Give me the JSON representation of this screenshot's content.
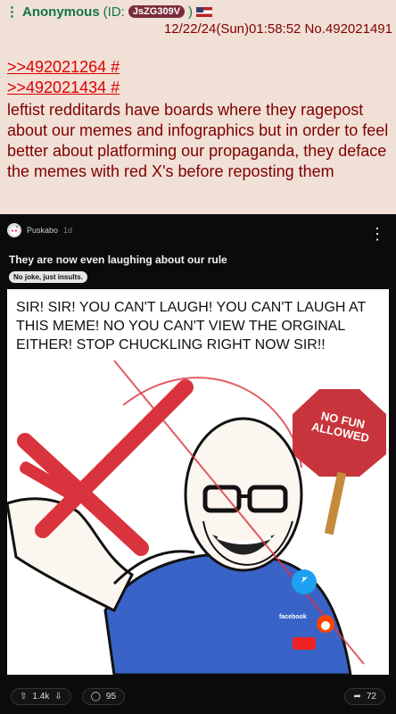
{
  "post": {
    "menu_icon": "vertical-dots-icon",
    "name": "Anonymous",
    "id_prefix": "(ID:",
    "id_value": "JsZG309V",
    "id_suffix": ")",
    "flag": "us-flag-icon",
    "datetime_num": "12/22/24(Sun)01:58:52 No.492021491",
    "quotes": [
      ">>492021264 #",
      ">>492021434 #"
    ],
    "body": "leftist redditards have boards where they ragepost about our memes and infographics but in order to feel better about platforming our propaganda, they deface the memes with red X's before reposting them"
  },
  "reddit": {
    "user": "Puskabo",
    "time": "1d",
    "more_icon": "more-vertical-icon",
    "title": "They are now even laughing about our rule",
    "flair": "No joke, just insults.",
    "meme_text": "SIR! SIR! YOU CAN'T LAUGH! YOU CAN'T LAUGH AT THIS MEME! NO YOU CAN'T VIEW THE ORGINAL EITHER! STOP CHUCKLING RIGHT NOW SIR!!",
    "sign_text": "NO FUN ALLOWED",
    "upvotes": "1.4k",
    "comments": "95",
    "shares": "72",
    "colors": {
      "x_red": "#d9343d",
      "shirt_blue": "#3a63c8",
      "sign_red": "#c7343c"
    }
  }
}
